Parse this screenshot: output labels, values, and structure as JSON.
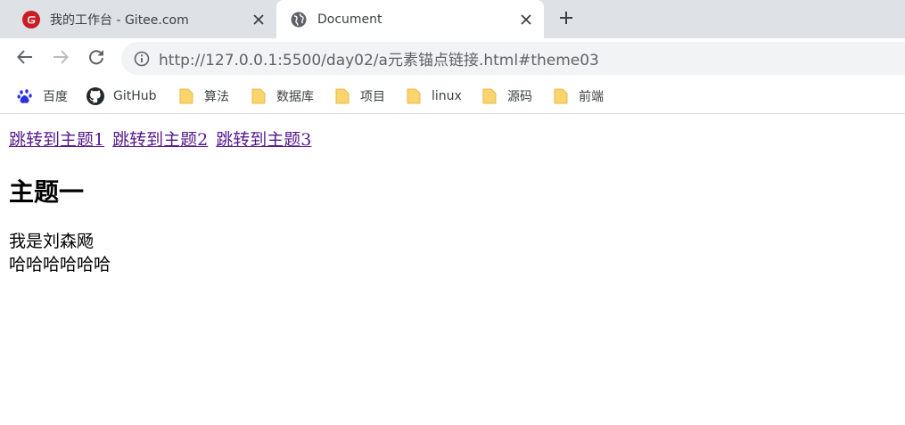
{
  "tabs": [
    {
      "title": "我的工作台 - Gitee.com",
      "icon": "gitee-icon",
      "active": false
    },
    {
      "title": "Document",
      "icon": "globe-icon",
      "active": true
    }
  ],
  "nav": {
    "back": "back-arrow",
    "forward": "forward-arrow",
    "reload": "reload"
  },
  "address": {
    "host": "http://127.0.0.1",
    "rest": ":5500/day02/a元素锚点链接.html#theme03"
  },
  "bookmarks": [
    {
      "label": "百度",
      "icon": "baidu-paw-icon"
    },
    {
      "label": "GitHub",
      "icon": "github-icon"
    },
    {
      "label": "算法",
      "icon": "folder-icon"
    },
    {
      "label": "数据库",
      "icon": "folder-icon"
    },
    {
      "label": "项目",
      "icon": "folder-icon"
    },
    {
      "label": "linux",
      "icon": "folder-icon"
    },
    {
      "label": "源码",
      "icon": "folder-icon"
    },
    {
      "label": "前端",
      "icon": "folder-icon"
    }
  ],
  "page": {
    "links": [
      "跳转到主题1",
      "跳转到主题2",
      "跳转到主题3"
    ],
    "heading": "主题一",
    "lines": [
      "我是刘森飏",
      "哈哈哈哈哈哈"
    ]
  },
  "colors": {
    "tabstrip": "#dee1e6",
    "link_visited": "#551a8b",
    "folder": "#fbd46d",
    "gitee_red": "#c71d23",
    "baidu_blue": "#2932e1"
  }
}
